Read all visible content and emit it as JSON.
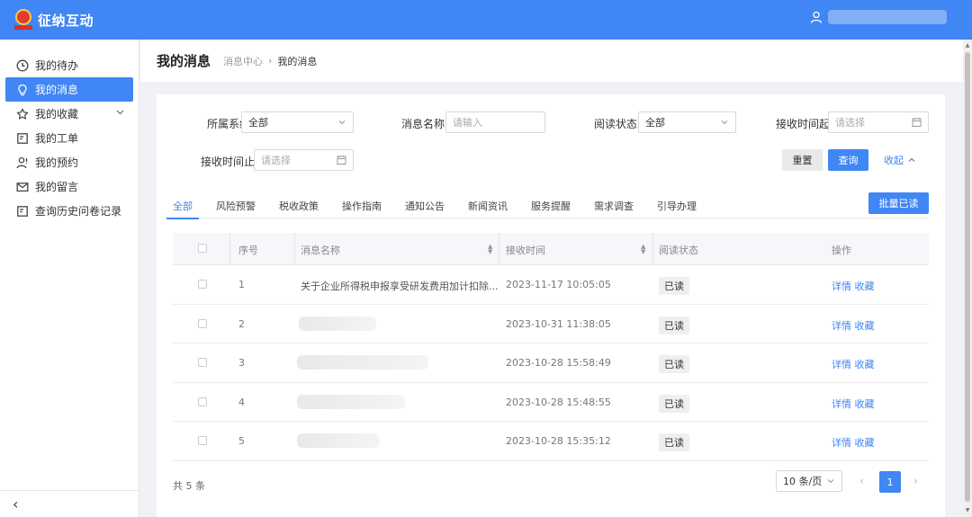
{
  "app": {
    "title": "征纳互动"
  },
  "sidebar": {
    "items": [
      {
        "label": "我的待办",
        "icon": "clock-icon"
      },
      {
        "label": "我的消息",
        "icon": "bulb-icon",
        "active": true
      },
      {
        "label": "我的收藏",
        "icon": "star-icon",
        "expandable": true
      },
      {
        "label": "我的工单",
        "icon": "form-icon"
      },
      {
        "label": "我的预约",
        "icon": "user-appointment-icon"
      },
      {
        "label": "我的留言",
        "icon": "mail-icon"
      },
      {
        "label": "查询历史问卷记录",
        "icon": "form-icon"
      }
    ],
    "collapse_glyph": "‹"
  },
  "page": {
    "title": "我的消息",
    "breadcrumb": [
      "消息中心",
      "我的消息"
    ],
    "breadcrumb_sep": "›"
  },
  "filters": {
    "system_label": "所属系统",
    "system_value": "全部",
    "name_label": "消息名称",
    "name_placeholder": "请输入",
    "read_label": "阅读状态",
    "read_value": "全部",
    "start_label": "接收时间起",
    "start_placeholder": "请选择",
    "end_label": "接收时间止",
    "end_placeholder": "请选择",
    "reset_label": "重置",
    "query_label": "查询",
    "collapse_label": "收起"
  },
  "tabs": [
    "全部",
    "风险预警",
    "税收政策",
    "操作指南",
    "通知公告",
    "新闻资讯",
    "服务提醒",
    "需求调查",
    "引导办理"
  ],
  "batch_read_label": "批量已读",
  "table": {
    "headers": [
      "序号",
      "消息名称",
      "接收时间",
      "阅读状态",
      "操作"
    ],
    "rows": [
      {
        "no": "1",
        "name": "关于企业所得税申报享受研发费用加计扣除...",
        "time": "2023-11-17 10:05:05",
        "status": "已读",
        "ops": "详情 收藏"
      },
      {
        "no": "2",
        "name": "",
        "time": "2023-10-31 11:38:05",
        "status": "已读",
        "ops": "详情 收藏"
      },
      {
        "no": "3",
        "name": "",
        "time": "2023-10-28 15:58:49",
        "status": "已读",
        "ops": "详情 收藏"
      },
      {
        "no": "4",
        "name": "",
        "time": "2023-10-28 15:48:55",
        "status": "已读",
        "ops": "详情 收藏"
      },
      {
        "no": "5",
        "name": "",
        "time": "2023-10-28 15:35:12",
        "status": "已读",
        "ops": "详情 收藏"
      }
    ]
  },
  "footer": {
    "total": "共 5 条",
    "page_size": "10 条/页",
    "current_page": "1",
    "prev_glyph": "‹",
    "next_glyph": "›"
  },
  "colors": {
    "primary": "#4086f4",
    "header": "#4086f4"
  }
}
